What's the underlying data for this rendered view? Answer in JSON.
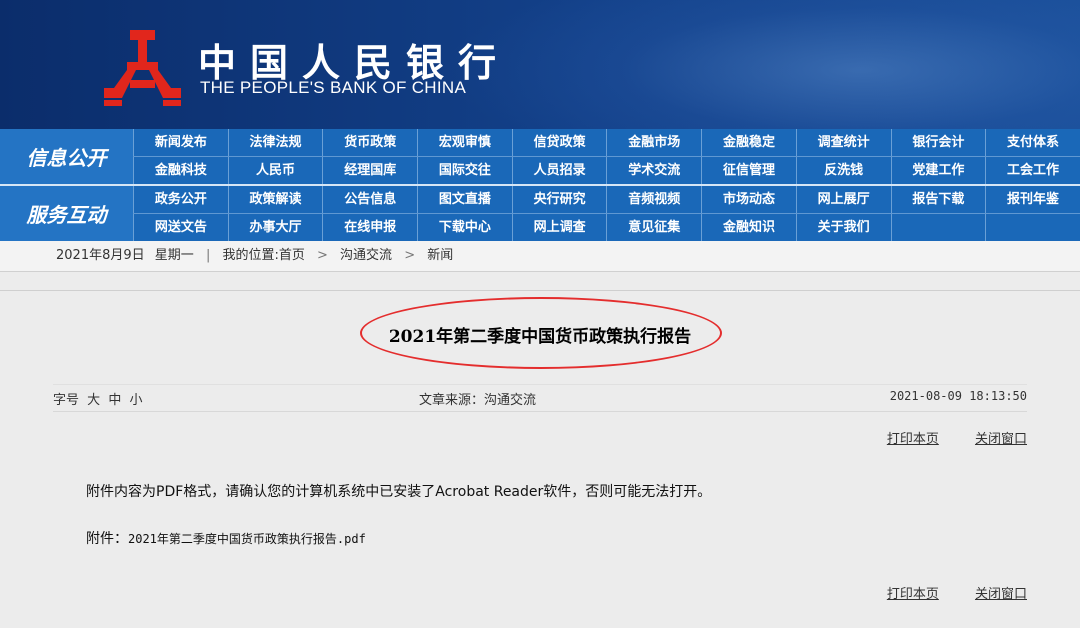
{
  "header": {
    "bank_name_cn": "中国人民银行",
    "bank_name_en": "THE PEOPLE'S BANK OF CHINA"
  },
  "nav": {
    "section1_label": "信息公开",
    "section1_rows": [
      [
        "新闻发布",
        "法律法规",
        "货币政策",
        "宏观审慎",
        "信贷政策",
        "金融市场",
        "金融稳定",
        "调查统计",
        "银行会计",
        "支付体系"
      ],
      [
        "金融科技",
        "人民币",
        "经理国库",
        "国际交往",
        "人员招录",
        "学术交流",
        "征信管理",
        "反洗钱",
        "党建工作",
        "工会工作"
      ]
    ],
    "section2_label": "服务互动",
    "section2_rows": [
      [
        "政务公开",
        "政策解读",
        "公告信息",
        "图文直播",
        "央行研究",
        "音频视频",
        "市场动态",
        "网上展厅",
        "报告下载",
        "报刊年鉴"
      ],
      [
        "网送文告",
        "办事大厅",
        "在线申报",
        "下载中心",
        "网上调查",
        "意见征集",
        "金融知识",
        "关于我们",
        "",
        ""
      ]
    ]
  },
  "breadcrumb": {
    "date": "2021年8月9日",
    "weekday": "星期一",
    "location_prefix": "我的位置:首页",
    "level2": "沟通交流",
    "level3": "新闻"
  },
  "article": {
    "title": "2021年第二季度中国货币政策执行报告",
    "font_size_label": "字号",
    "font_large": "大",
    "font_medium": "中",
    "font_small": "小",
    "source": "文章来源：沟通交流",
    "datetime": "2021-08-09  18:13:50",
    "print_label": "打印本页",
    "close_label": "关闭窗口",
    "notice": "附件内容为PDF格式，请确认您的计算机系统中已安装了Acrobat Reader软件，否则可能无法打开。",
    "attach_label": "附件：",
    "attach_file": "2021年第二季度中国货币政策执行报告.pdf"
  },
  "colors": {
    "header_bg": "#0b2d6b",
    "nav_bg": "#1a68b8",
    "logo_red": "#e1261c",
    "highlight_oval": "#e42d2d"
  }
}
